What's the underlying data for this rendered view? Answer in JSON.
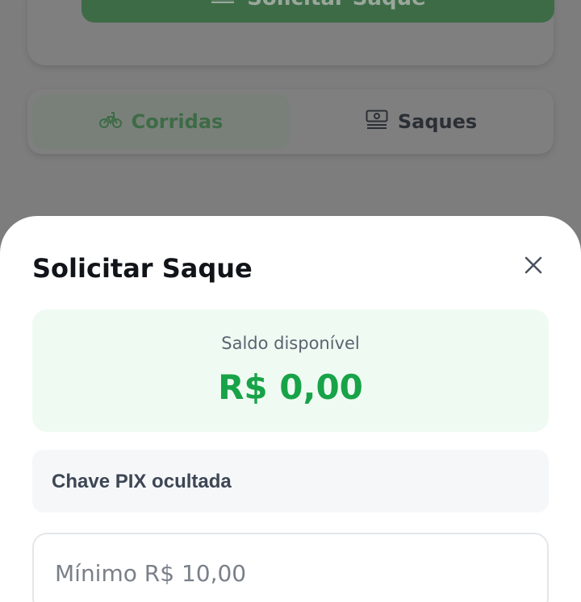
{
  "background": {
    "withdraw_button_label": "Solicitar Saque",
    "tabs": [
      {
        "label": "Corridas",
        "icon": "bicycle-icon",
        "active": true
      },
      {
        "label": "Saques",
        "icon": "money-icon",
        "active": false
      }
    ]
  },
  "modal": {
    "title": "Solicitar Saque",
    "close_icon": "close-icon",
    "balance": {
      "label": "Saldo disponível",
      "value": "R$ 0,00"
    },
    "pix_label": "Chave PIX ocultada",
    "amount_placeholder": "Mínimo R$ 10,00",
    "amount_value": ""
  },
  "colors": {
    "brand_green": "#18a348",
    "button_green_dimmed": "#3d6b46",
    "balance_bg": "#effbf2"
  }
}
